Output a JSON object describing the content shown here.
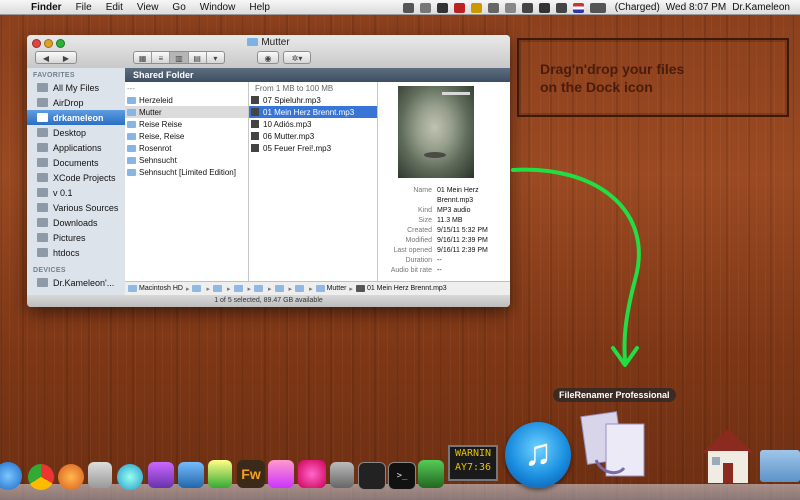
{
  "menubar": {
    "items": [
      "Finder",
      "File",
      "Edit",
      "View",
      "Go",
      "Window",
      "Help"
    ],
    "battery": "(Charged)",
    "datetime": "Wed 8:07 PM",
    "user": "Dr.Kameleon"
  },
  "window": {
    "title": "Mutter",
    "sidebar": {
      "favorites_header": "FAVORITES",
      "favorites": [
        "All My Files",
        "AirDrop",
        "drkameleon",
        "Desktop",
        "Applications",
        "Documents",
        "XCode Projects",
        "v 0.1",
        "Various Sources",
        "Downloads",
        "Pictures",
        "htdocs"
      ],
      "selected_index": 2,
      "devices_header": "DEVICES",
      "devices": [
        "Dr.Kameleon'..."
      ]
    },
    "header_title": "Shared Folder",
    "column1": {
      "dash": "---",
      "items": [
        "Herzeleid",
        "Mutter",
        "Reise Reise",
        "Reise, Reise",
        "Rosenrot",
        "Sehnsucht",
        "Sehnsucht [Limited Edition]"
      ],
      "selected_index": 1
    },
    "column2": {
      "group": "From 1 MB to 100 MB",
      "items": [
        "07 Spieluhr.mp3",
        "01 Mein Herz Brennt.mp3",
        "10 Adiós.mp3",
        "06 Mutter.mp3",
        "05 Feuer Frei!.mp3"
      ],
      "selected_index": 1
    },
    "info": {
      "name_label": "Name",
      "name_value": "01 Mein Herz",
      "name_value2": "Brennt.mp3",
      "kind_label": "Kind",
      "kind_value": "MP3 audio",
      "size_label": "Size",
      "size_value": "11.3 MB",
      "created_label": "Created",
      "created_value": "9/15/11 5:32 PM",
      "modified_label": "Modified",
      "modified_value": "9/16/11 2:39 PM",
      "opened_label": "Last opened",
      "opened_value": "9/16/11 2:39 PM",
      "duration_label": "Duration",
      "duration_value": "--",
      "bitrate_label": "Audio bit rate",
      "bitrate_value": "--"
    },
    "path": {
      "start": "Macintosh HD",
      "folder": "Mutter",
      "file": "01 Mein Herz Brennt.mp3"
    },
    "status": "1 of 5 selected, 89.47 GB available"
  },
  "hint": {
    "line1": "Drag'n'drop your files",
    "line2": "on the Dock icon"
  },
  "dock": {
    "label": "FileRenamer Professional",
    "warn_line1": "WARNIN",
    "warn_line2": "AY7:36"
  },
  "colors": {
    "arrow": "#22dd44",
    "selection": "#3875d7"
  }
}
